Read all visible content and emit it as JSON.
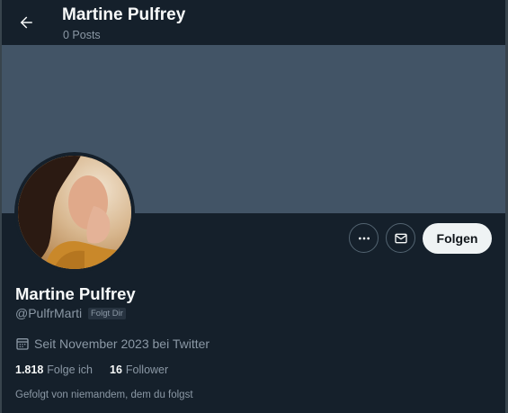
{
  "header": {
    "title": "Martine Pulfrey",
    "post_count": "0 Posts"
  },
  "profile": {
    "display_name": "Martine Pulfrey",
    "handle": "@PulfrMarti",
    "follows_you_badge": "Folgt Dir",
    "joined": "Seit November 2023 bei Twitter",
    "following_count": "1.818",
    "following_label": "Folge ich",
    "followers_count": "16",
    "followers_label": "Follower",
    "followed_by": "Gefolgt von niemandem, dem du folgst"
  },
  "actions": {
    "follow_label": "Folgen"
  },
  "icons": {
    "back": "arrow-left-icon",
    "more": "more-horizontal-icon",
    "message": "envelope-icon",
    "calendar": "calendar-icon"
  },
  "colors": {
    "background": "#15202b",
    "banner": "#425466",
    "primary_text": "#f7f9f9",
    "secondary_text": "#8b98a5",
    "follow_button_bg": "#eff3f4"
  }
}
